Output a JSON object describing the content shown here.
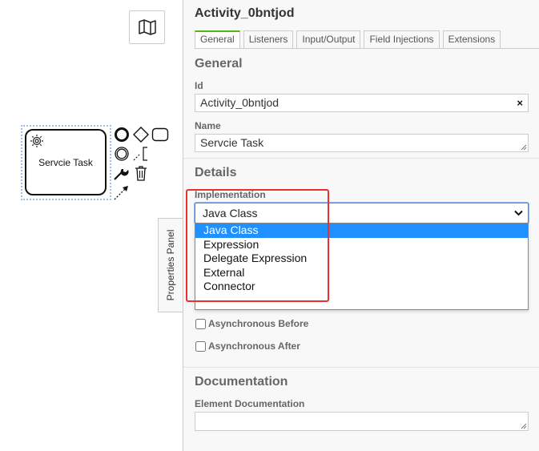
{
  "canvas": {
    "map_icon": "map-icon",
    "task": {
      "label": "Servcie Task",
      "icon": "gear-icon"
    },
    "context_pad": [
      "end-event-icon",
      "gateway-icon",
      "task-icon",
      "intermediate-event-icon",
      "text-annotation-icon",
      "change-type-icon",
      "delete-icon",
      "connect-icon"
    ],
    "properties_toggle": "Properties Panel"
  },
  "panel": {
    "title": "Activity_0bntjod",
    "tabs": [
      {
        "label": "General",
        "active": true
      },
      {
        "label": "Listeners"
      },
      {
        "label": "Input/Output"
      },
      {
        "label": "Field Injections"
      },
      {
        "label": "Extensions"
      }
    ],
    "general": {
      "heading": "General",
      "id_label": "Id",
      "id_value": "Activity_0bntjod",
      "clear_symbol": "×",
      "name_label": "Name",
      "name_value": "Servcie Task"
    },
    "details": {
      "heading": "Details",
      "implementation_label": "Implementation",
      "implementation_value": "Java Class",
      "options": [
        "Java Class",
        "Expression",
        "Delegate Expression",
        "External",
        "Connector"
      ],
      "selected_option": "Java Class",
      "async_before": "Asynchronous Before",
      "async_after": "Asynchronous After"
    },
    "documentation": {
      "heading": "Documentation",
      "element_doc_label": "Element Documentation",
      "element_doc_value": ""
    }
  },
  "colors": {
    "accent_tab": "#52b415",
    "selected_option": "#1e90ff",
    "highlight_box": "#e8312f"
  }
}
